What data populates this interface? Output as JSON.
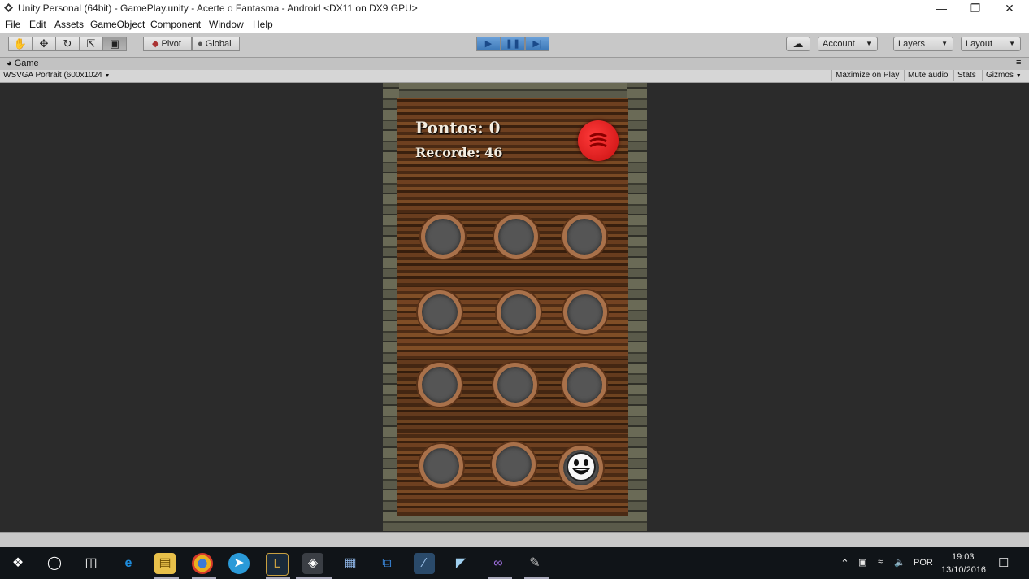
{
  "window": {
    "title": "Unity Personal (64bit) - GamePlay.unity - Acerte o Fantasma - Android <DX11 on DX9 GPU>"
  },
  "menu": [
    "File",
    "Edit",
    "Assets",
    "GameObject",
    "Component",
    "Window",
    "Help"
  ],
  "toolbar": {
    "pivot_label": "Pivot",
    "global_label": "Global",
    "account_label": "Account",
    "layers_label": "Layers",
    "layout_label": "Layout"
  },
  "game_panel": {
    "tab_label": "Game",
    "resolution": "WSVGA Portrait (600x1024",
    "maximize_on_play": "Maximize on Play",
    "mute_audio": "Mute audio",
    "stats": "Stats",
    "gizmos": "Gizmos"
  },
  "game": {
    "points_label": "Pontos: 0",
    "record_label": "Recorde: 46",
    "holes_rows": 4,
    "holes_cols": 3,
    "ghost_position": "row 4, column 3"
  },
  "taskbar": {
    "language": "POR",
    "time": "19:03",
    "date": "13/10/2016"
  },
  "colors": {
    "toolbar_bg": "#c8c8c8",
    "play_active": "#4a86c6",
    "taskbar_bg": "#101418",
    "pause_button_red": "#d81818"
  }
}
